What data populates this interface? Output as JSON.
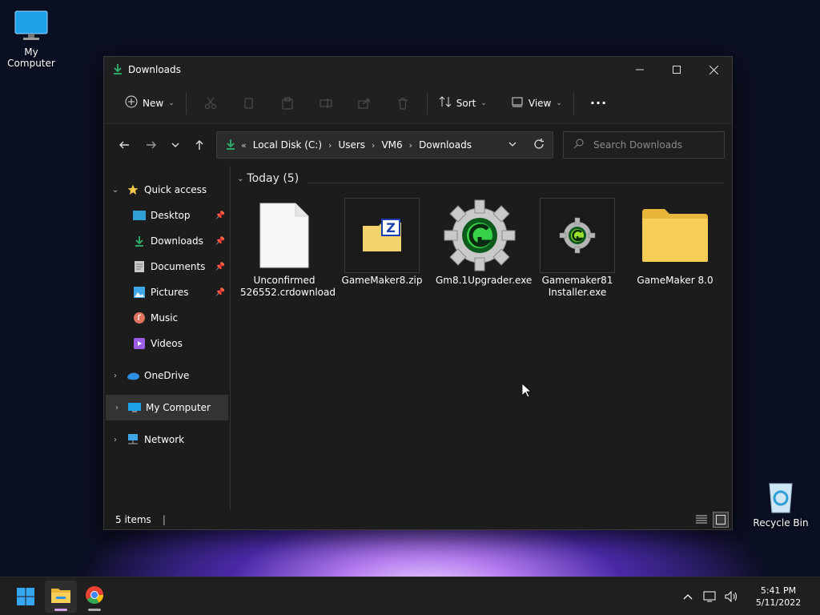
{
  "desktop": {
    "icons": [
      {
        "label": "My Computer"
      },
      {
        "label": "Recycle Bin"
      }
    ]
  },
  "window": {
    "title": "Downloads",
    "toolbar": {
      "new_label": "New",
      "sort_label": "Sort",
      "view_label": "View"
    },
    "address": {
      "prefix": "«",
      "crumbs": [
        "Local Disk (C:)",
        "Users",
        "VM6",
        "Downloads"
      ]
    },
    "search": {
      "placeholder": "Search Downloads"
    },
    "nav": {
      "quick_access": "Quick access",
      "items": [
        "Desktop",
        "Downloads",
        "Documents",
        "Pictures",
        "Music",
        "Videos"
      ],
      "onedrive": "OneDrive",
      "my_computer": "My Computer",
      "network": "Network"
    },
    "group_header": "Today (5)",
    "files": [
      {
        "name": "Unconfirmed 526552.crdownload"
      },
      {
        "name": "GameMaker8.zip"
      },
      {
        "name": "Gm8.1Upgrader.exe"
      },
      {
        "name": "Gamemaker81 Installer.exe"
      },
      {
        "name": "GameMaker 8.0"
      }
    ],
    "status": "5 items"
  },
  "taskbar": {
    "time": "5:41 PM",
    "date": "5/11/2022"
  },
  "colors": {
    "accent_download": "#2fb36b",
    "folder_yellow": "#f3c94a",
    "window_bg": "#1c1c1c"
  }
}
